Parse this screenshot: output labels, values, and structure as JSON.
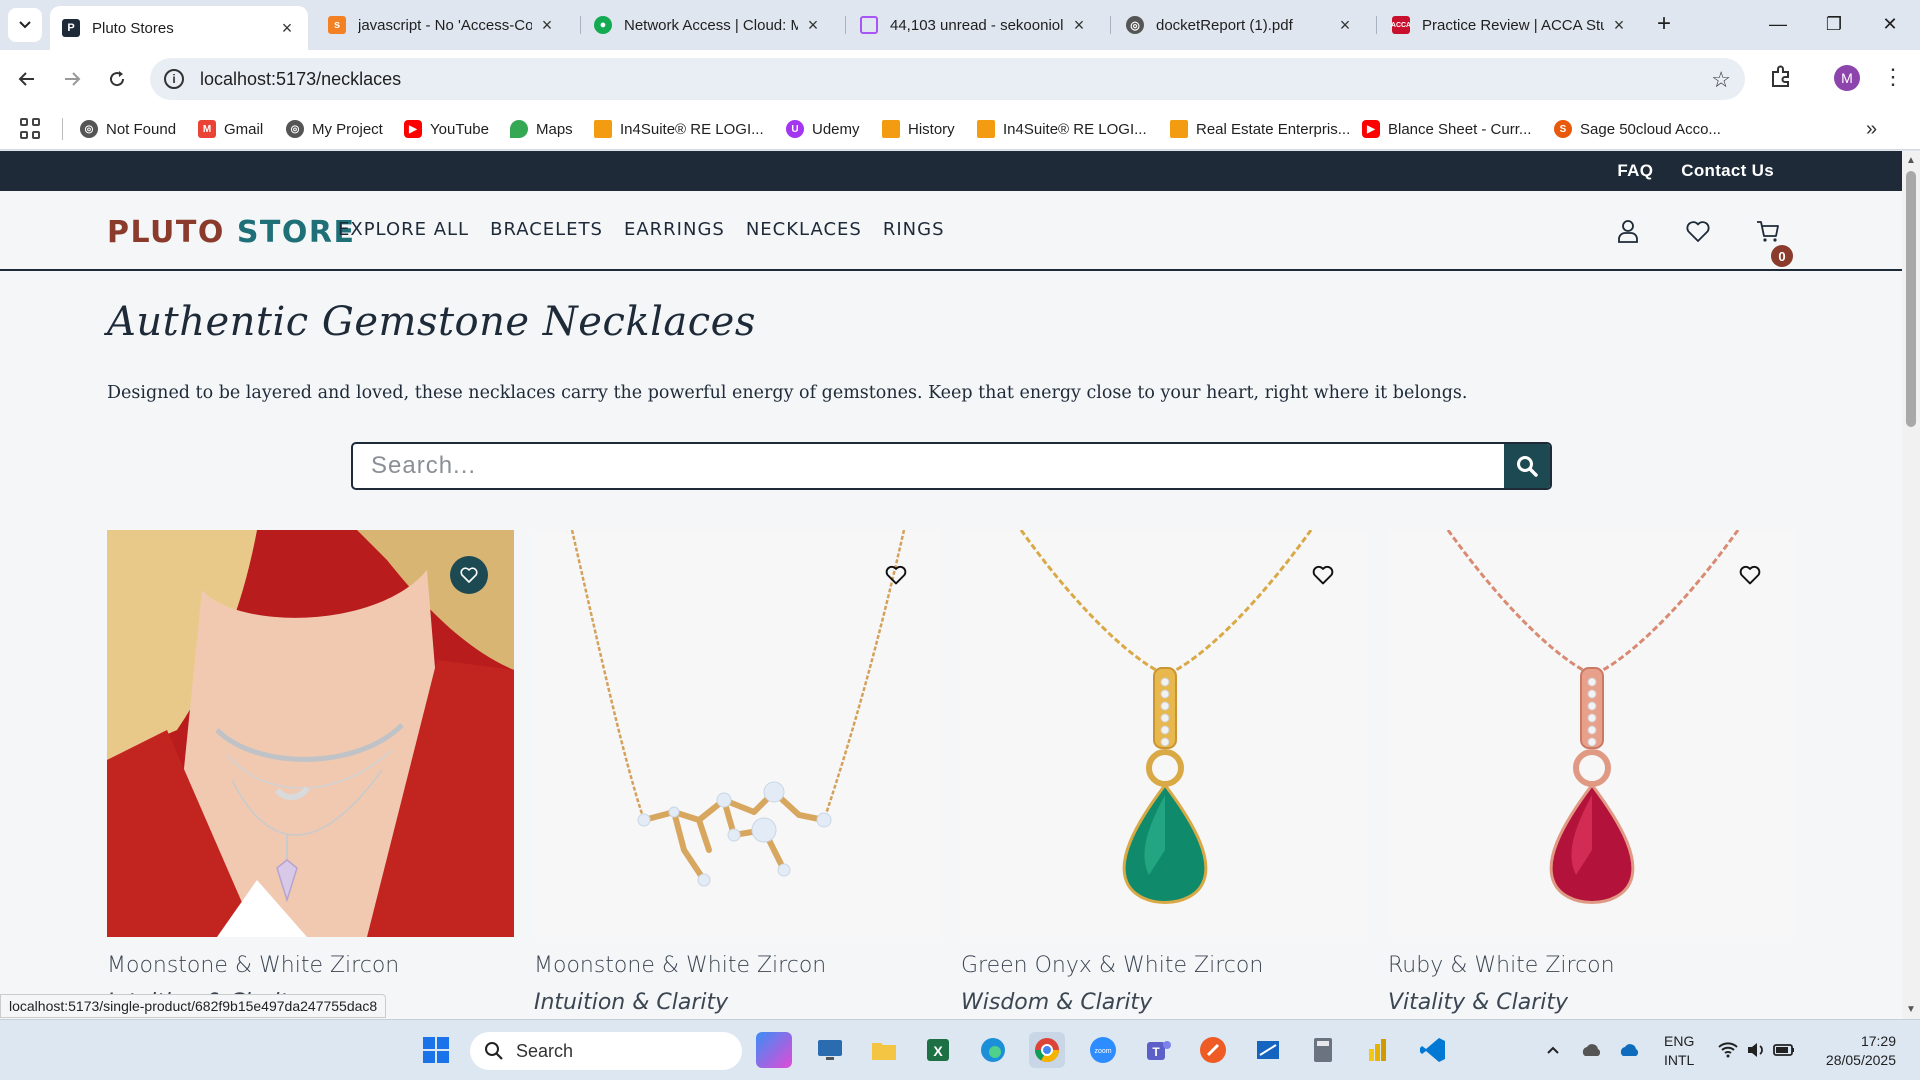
{
  "browser": {
    "tabs": [
      {
        "title": "Pluto Stores",
        "active": true,
        "icon": "pluto-favicon"
      },
      {
        "title": "javascript - No 'Access-Co",
        "active": false,
        "icon": "stackoverflow-favicon"
      },
      {
        "title": "Network Access | Cloud: M",
        "active": false,
        "icon": "mongodb-favicon"
      },
      {
        "title": "44,103 unread - sekooniol",
        "active": false,
        "icon": "mail-favicon"
      },
      {
        "title": "docketReport (1).pdf",
        "active": false,
        "icon": "globe-favicon"
      },
      {
        "title": "Practice Review | ACCA Stu",
        "active": false,
        "icon": "acca-favicon"
      }
    ],
    "url": "localhost:5173/necklaces",
    "profile_initial": "M",
    "bookmarks": [
      {
        "label": "Not Found",
        "icon": "globe-icon"
      },
      {
        "label": "Gmail",
        "icon": "gmail-icon"
      },
      {
        "label": "My Project",
        "icon": "globe-icon"
      },
      {
        "label": "YouTube",
        "icon": "youtube-icon"
      },
      {
        "label": "Maps",
        "icon": "maps-icon"
      },
      {
        "label": "In4Suite® RE LOGI...",
        "icon": "in4suite-icon"
      },
      {
        "label": "Udemy",
        "icon": "udemy-icon"
      },
      {
        "label": "History",
        "icon": "in4suite-icon"
      },
      {
        "label": "In4Suite® RE LOGI...",
        "icon": "in4suite-icon"
      },
      {
        "label": "Real Estate Enterpris...",
        "icon": "in4suite-icon"
      },
      {
        "label": "Blance Sheet - Curr...",
        "icon": "youtube-icon"
      },
      {
        "label": "Sage 50cloud Acco...",
        "icon": "sage-icon"
      }
    ],
    "status_url": "localhost:5173/single-product/682f9b15e497da247755dac8"
  },
  "site": {
    "topbar": {
      "faq": "FAQ",
      "contact": "Contact Us"
    },
    "logo": {
      "part1": "PLUTO",
      "part2": "STORE"
    },
    "nav": [
      "EXPLORE ALL",
      "BRACELETS",
      "EARRINGS",
      "NECKLACES",
      "RINGS"
    ],
    "cart_count": "0",
    "headline": "Authentic Gemstone Necklaces",
    "intro": "Designed to be layered and loved, these necklaces carry the powerful energy of gemstones. Keep that energy close to your heart, right where it belongs.",
    "search_placeholder": "Search...",
    "products": [
      {
        "name": "Moonstone & White Zircon",
        "subtitle": "Intuition & Clarity",
        "favorited": true
      },
      {
        "name": "Moonstone & White Zircon",
        "subtitle": "Intuition & Clarity",
        "favorited": false
      },
      {
        "name": "Green Onyx & White Zircon",
        "subtitle": "Wisdom & Clarity",
        "favorited": false
      },
      {
        "name": "Ruby & White Zircon",
        "subtitle": "Vitality & Clarity",
        "favorited": false
      }
    ]
  },
  "taskbar": {
    "search_label": "Search",
    "lang": "ENG",
    "layout": "INTL",
    "time": "17:29",
    "date": "28/05/2025"
  },
  "colors": {
    "navy": "#1e2a38",
    "teal": "#1d4a52",
    "logo_red": "#8a3b2c",
    "logo_teal": "#1f6f78"
  }
}
